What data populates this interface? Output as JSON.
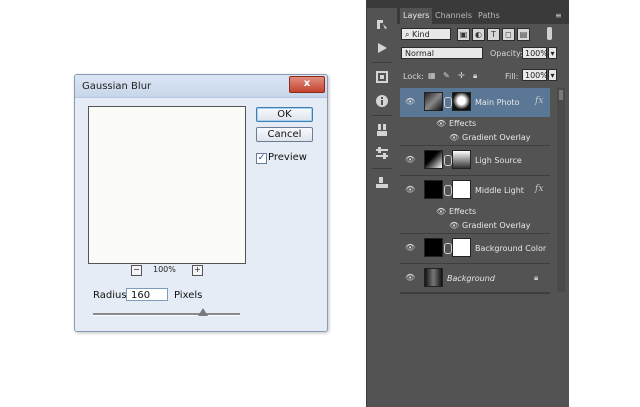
{
  "dialog": {
    "title": "Gaussian Blur",
    "close_label": "x",
    "ok_label": "OK",
    "cancel_label": "Cancel",
    "preview_label": "Preview",
    "preview_checked_glyph": "✓",
    "zoom_level": "100%",
    "zoom_out_label": "−",
    "zoom_in_label": "+",
    "radius_label": "Radius:",
    "radius_value": "160",
    "radius_unit": "Pixels"
  },
  "layers_panel": {
    "tabs": [
      "Layers",
      "Channels",
      "Paths"
    ],
    "filter_label": "Kind",
    "blend_mode": "Normal",
    "opacity_label": "Opacity:",
    "opacity_value": "100%",
    "lock_label": "Lock:",
    "fill_label": "Fill:",
    "fill_value": "100%",
    "layers": [
      {
        "name": "Main Photo",
        "fx": "fx",
        "effects_label": "Effects",
        "effect": "Gradient Overlay"
      },
      {
        "name": "Ligh Source"
      },
      {
        "name": "Middle Light",
        "fx": "fx",
        "effects_label": "Effects",
        "effect": "Gradient Overlay"
      },
      {
        "name": "Background Color"
      },
      {
        "name": "Background"
      }
    ]
  },
  "colors": {
    "panel_bg": "#535353",
    "selected_row": "#5a7895",
    "dialog_bg": "#e6ecf5",
    "close_button": "#c4442e"
  }
}
